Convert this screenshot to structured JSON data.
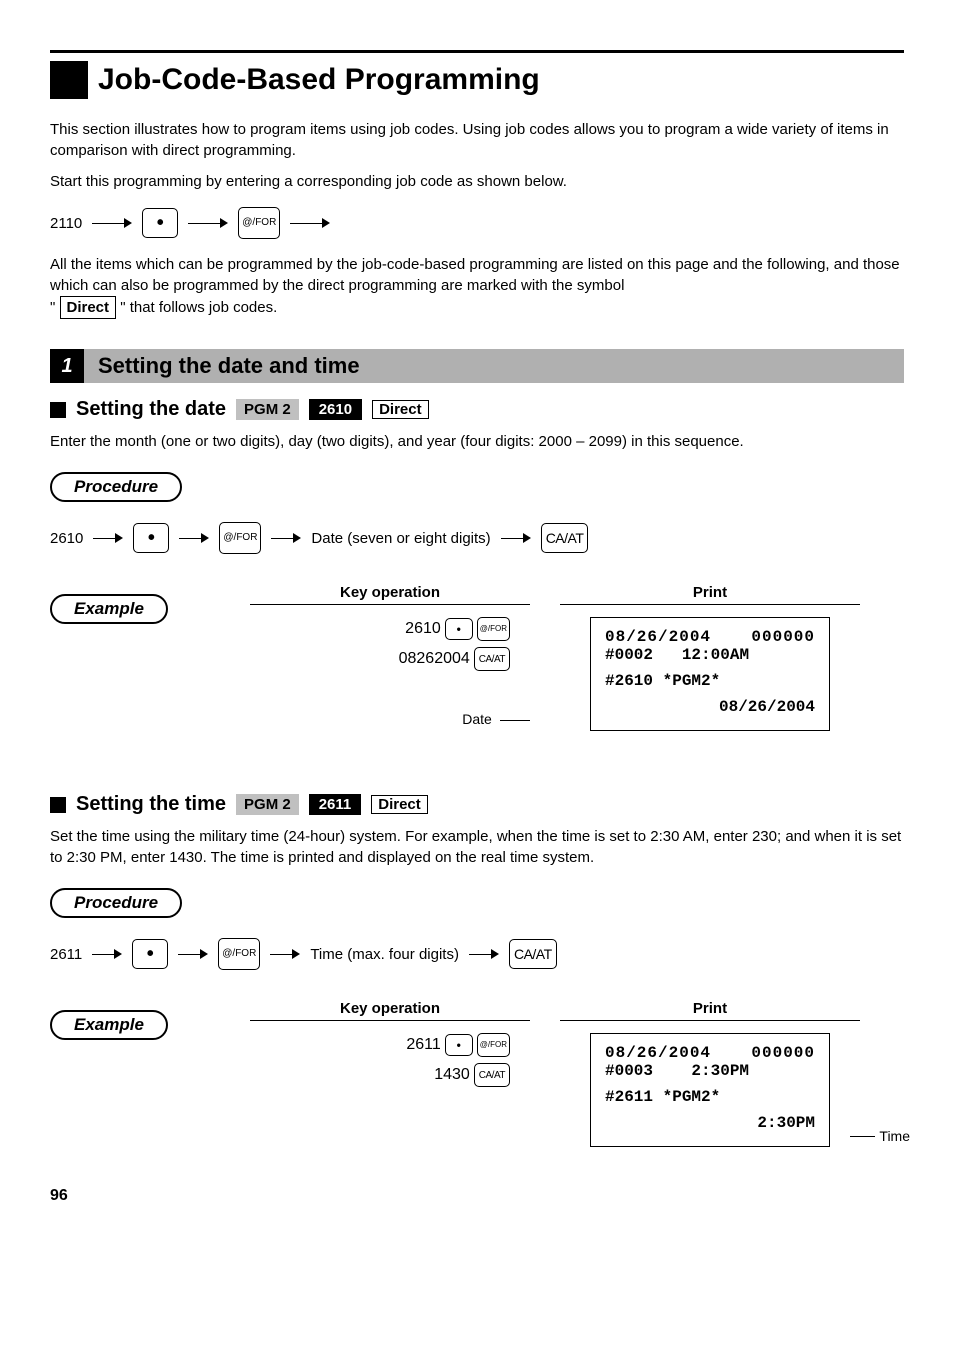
{
  "page_number": "96",
  "main_title": "Job-Code-Based Programming",
  "intro_p1": "This section illustrates how to program items using job codes. Using job codes allows you to program a wide variety of items in comparison with direct programming.",
  "intro_p2": "Start this programming by entering a corresponding job code as shown below.",
  "intro_flow_code": "2110",
  "intro_p3a": "All the items which can be programmed by the job-code-based programming are listed on this page and the following, and those which can also be programmed by the direct programming are marked with the symbol",
  "intro_p3b": "\" that follows job codes.",
  "intro_p3_quote": "\"",
  "direct_label": "Direct",
  "dot_key": "•",
  "atfor_top": "@/",
  "atfor_bot": "FOR",
  "caat_label": "CA/AT",
  "section1": {
    "num": "1",
    "title": "Setting the date and time"
  },
  "date": {
    "heading": "Setting the date",
    "pgm": "PGM 2",
    "code": "2610",
    "direct": "Direct",
    "desc": "Enter the month (one or two digits), day (two digits), and year (four digits: 2000 – 2099) in this sequence.",
    "procedure_label": "Procedure",
    "flow_code": "2610",
    "flow_text": "Date (seven or eight digits)",
    "example_label": "Example",
    "keyop_header": "Key operation",
    "print_header": "Print",
    "keyop_line1_code": "2610",
    "keyop_line2_code": "08262004",
    "callout": "Date",
    "receipt": {
      "date": "08/26/2004",
      "zeros": "000000",
      "hash_num": "#0002",
      "time": "12:00AM",
      "hash_code": "#2610",
      "pgm": "*PGM2*",
      "value": "08/26/2004"
    }
  },
  "time": {
    "heading": "Setting the time",
    "pgm": "PGM 2",
    "code": "2611",
    "direct": "Direct",
    "desc": "Set the time using the military time (24-hour) system.  For example, when the time is set to 2:30 AM, enter 230; and when it is set to 2:30 PM, enter 1430. The time is printed and displayed on the real time system.",
    "procedure_label": "Procedure",
    "flow_code": "2611",
    "flow_text": "Time (max. four digits)",
    "example_label": "Example",
    "keyop_header": "Key operation",
    "print_header": "Print",
    "keyop_line1_code": "2611",
    "keyop_line2_code": "1430",
    "callout": "Time",
    "receipt": {
      "date": "08/26/2004",
      "zeros": "000000",
      "hash_num": "#0003",
      "time": "2:30PM",
      "hash_code": "#2611",
      "pgm": "*PGM2*",
      "value": "2:30PM"
    }
  }
}
